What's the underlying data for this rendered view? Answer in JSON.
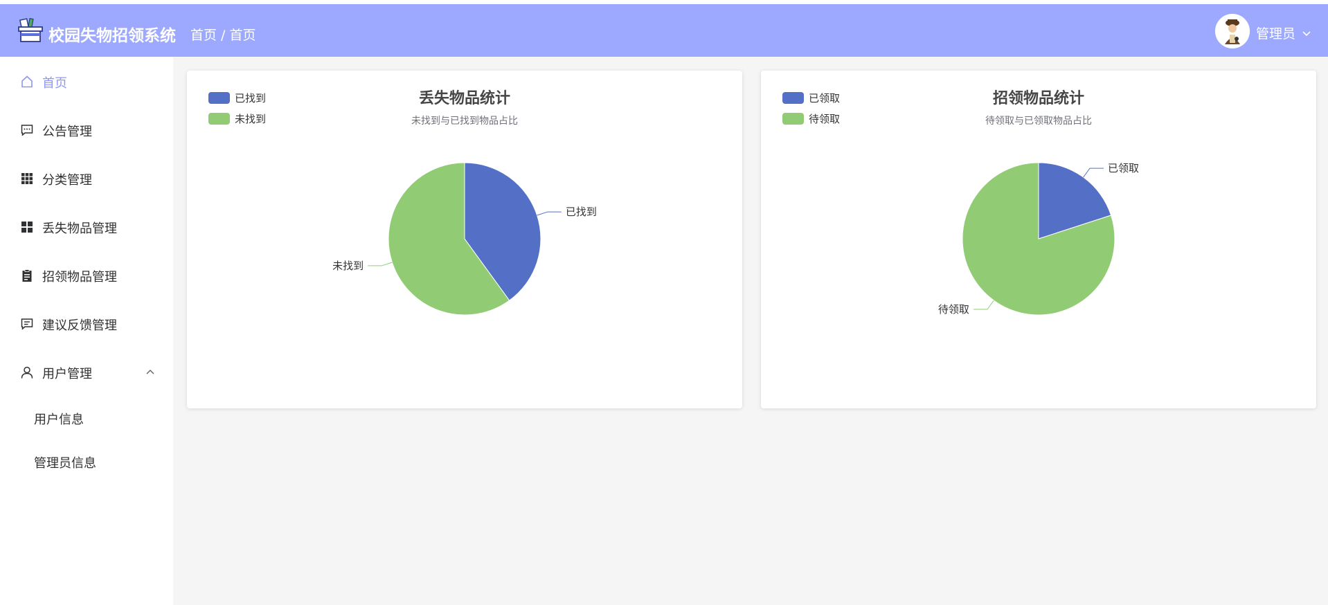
{
  "header": {
    "title": "校园失物招领系统",
    "breadcrumb": "首页 / 首页",
    "user": "管理员",
    "colors": {
      "bar": "#9ca9ff",
      "text": "#ffffff"
    }
  },
  "sidebar": {
    "active_color": "#8f96f5",
    "items": [
      {
        "label": "首页",
        "icon": "home-icon"
      },
      {
        "label": "公告管理",
        "icon": "message-icon"
      },
      {
        "label": "分类管理",
        "icon": "grid-icon"
      },
      {
        "label": "丢失物品管理",
        "icon": "apps-icon"
      },
      {
        "label": "招领物品管理",
        "icon": "clipboard-icon"
      },
      {
        "label": "建议反馈管理",
        "icon": "feedback-icon"
      },
      {
        "label": "用户管理",
        "icon": "user-icon"
      }
    ],
    "sub_items": [
      {
        "label": "用户信息"
      },
      {
        "label": "管理员信息"
      }
    ]
  },
  "chart_data": [
    {
      "type": "pie",
      "title": "丢失物品统计",
      "subtitle": "未找到与已找到物品占比",
      "legend_position": "top-left",
      "categories": [
        "已找到",
        "未找到"
      ],
      "values": [
        40,
        60
      ],
      "colors": [
        "#5470c6",
        "#91cc75"
      ]
    },
    {
      "type": "pie",
      "title": "招领物品统计",
      "subtitle": "待领取与已领取物品占比",
      "legend_position": "top-left",
      "categories": [
        "已领取",
        "待领取"
      ],
      "values": [
        20,
        80
      ],
      "colors": [
        "#5470c6",
        "#91cc75"
      ]
    }
  ]
}
